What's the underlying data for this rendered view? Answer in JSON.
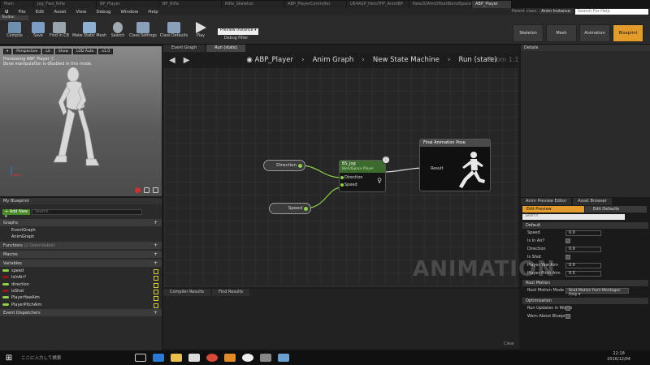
{
  "doc_tabs": [
    "Main",
    "Jog_Fwd_Rifle",
    "BP_Player",
    "BP_Rifle",
    "Rifle_Skeleton",
    "ABP_PlayerController",
    "UE4ASP_HeroTPP_AnimBP",
    "New2DAimOffsetBlendSpace",
    "ABP_Player"
  ],
  "menu": [
    "File",
    "Edit",
    "Asset",
    "View",
    "Debug",
    "Window",
    "Help"
  ],
  "parent_class": {
    "label": "Parent class:",
    "value": "Anim Instance"
  },
  "search_help_placeholder": "Search For Help",
  "compiler_tab": "Toolbar",
  "toolbar": {
    "compile": "Compile",
    "save": "Save",
    "find_in_cb": "Find in CB",
    "make_static_mesh": "Make Static Mesh",
    "search": "Search",
    "class_settings": "Class Settings",
    "class_defaults": "Class Defaults",
    "play": "Play",
    "preview_instance": "Preview Instance ▾",
    "debug_filter": "Debug Filter"
  },
  "modes": [
    "Skeleton",
    "Mesh",
    "Animation",
    "Blueprint"
  ],
  "viewport": {
    "buttons": [
      "Perspective",
      "Lit",
      "Show",
      "LOD Auto",
      "x1.0"
    ],
    "previewing": "Previewing ABP_Player_C",
    "bone_msg": "Bone manipulation is disabled in this mode."
  },
  "my_blueprint": {
    "title": "My Blueprint",
    "add_new": "+ Add New ▾",
    "search_placeholder": "Search",
    "graphs_label": "Graphs",
    "graphs": [
      "EventGraph",
      "AnimGraph"
    ],
    "functions_label": "Functions",
    "functions_note": "(2 Overridable)",
    "macros_label": "Macros",
    "variables_label": "Variables",
    "variables": [
      {
        "name": "speed",
        "color": "#8dd04a"
      },
      {
        "name": "isInAir?",
        "color": "#8b1a1a"
      },
      {
        "name": "direction",
        "color": "#8dd04a"
      },
      {
        "name": "isShot",
        "color": "#8b1a1a"
      },
      {
        "name": "PlayerYawAim",
        "color": "#8dd04a"
      },
      {
        "name": "PlayerPitchAim",
        "color": "#8dd04a"
      }
    ],
    "event_dispatchers_label": "Event Dispatchers"
  },
  "graph_tabs": [
    "Event Graph",
    "Run (state)"
  ],
  "breadcrumb": [
    "ABP_Player",
    "Anim Graph",
    "New State Machine",
    "Run (state)"
  ],
  "zoom": "Zoom 1:1",
  "nodes": {
    "direction": "Direction",
    "speed": "Speed",
    "bs_title": "BS_Jog",
    "bs_sub": "BlendSpace Player",
    "bs_pin1": "Direction",
    "bs_pin2": "Speed",
    "final_title": "Final Animation Pose",
    "final_result": "Result"
  },
  "watermark": "ANIMATION",
  "bottom_tabs": [
    "Compiler Results",
    "Find Results"
  ],
  "clear_label": "Clear",
  "details_title": "Details",
  "panel_tabs": [
    "Anim Preview Editor",
    "Asset Browser"
  ],
  "edit_preview": "Edit Preview",
  "edit_defaults": "Edit Defaults",
  "details_search_placeholder": "Search",
  "default_label": "Default",
  "props": [
    {
      "label": "Speed",
      "type": "num",
      "value": "0.0"
    },
    {
      "label": "Is In Air?",
      "type": "chk"
    },
    {
      "label": "Direction",
      "type": "num",
      "value": "0.0"
    },
    {
      "label": "Is Shot",
      "type": "chk"
    },
    {
      "label": "Player Yaw Aim",
      "type": "num",
      "value": "0.0"
    },
    {
      "label": "Player Pitch Aim",
      "type": "num",
      "value": "0.0"
    }
  ],
  "root_motion_label": "Root Motion",
  "root_motion_mode": {
    "label": "Root Motion Mode",
    "value": "Root Motion from Montages Only ▾"
  },
  "optimization_label": "Optimization",
  "opt_props": [
    "Run Updates in Worke",
    "Warn About Blueprint"
  ],
  "taskbar": {
    "search_placeholder": "ここに入力して検索",
    "time": "22:18",
    "date": "2016/12/04"
  },
  "colors": {
    "accent": "#e39c2c",
    "anim_green": "#3d6b2d",
    "pin_green": "#8dd04a"
  }
}
